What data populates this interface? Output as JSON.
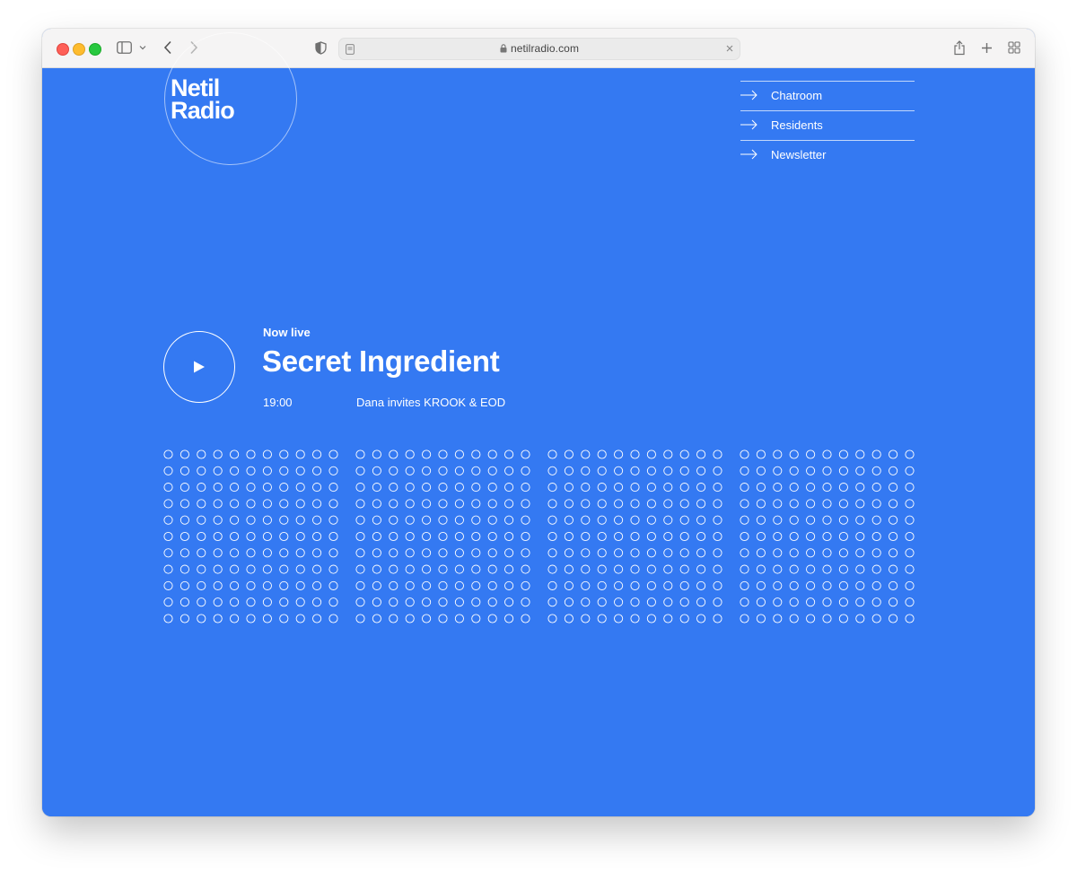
{
  "browser": {
    "url": "netilradio.com"
  },
  "site": {
    "logo_line1": "Netil",
    "logo_line2": "Radio"
  },
  "nav": {
    "items": [
      {
        "label": "Chatroom"
      },
      {
        "label": "Residents"
      },
      {
        "label": "Newsletter"
      }
    ]
  },
  "player": {
    "status": "Now live",
    "show_title": "Secret Ingredient",
    "time": "19:00",
    "description": "Dana invites KROOK & EOD"
  },
  "colors": {
    "background": "#3479f2",
    "foreground": "#ffffff"
  }
}
